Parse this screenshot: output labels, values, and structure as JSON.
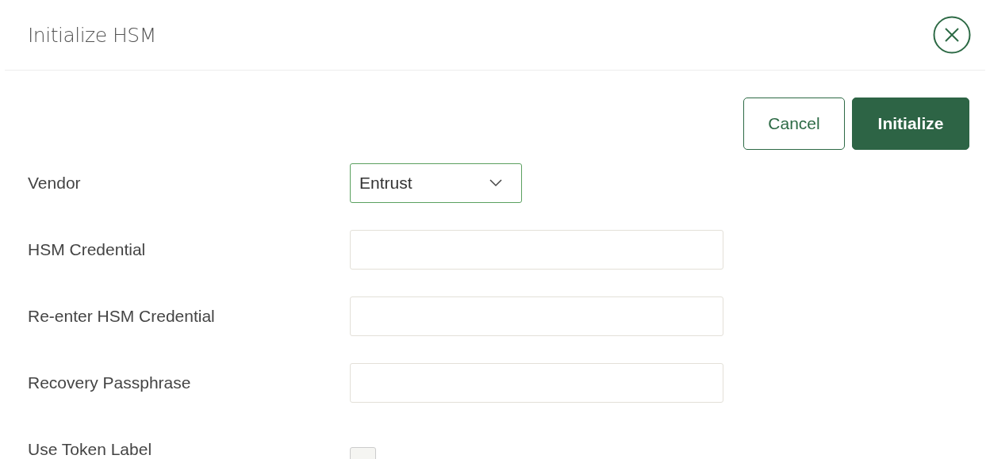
{
  "dialog": {
    "title": "Initialize HSM"
  },
  "buttons": [
    {
      "label": "Cancel",
      "kind": "secondary"
    },
    {
      "label": "Initialize",
      "kind": "primary"
    }
  ],
  "fields": [
    {
      "label": "Vendor",
      "kind": "select",
      "value": "Entrust"
    },
    {
      "label": "HSM Credential",
      "kind": "text"
    },
    {
      "label": "Re-enter HSM Credential",
      "kind": "text"
    },
    {
      "label": "Recovery Passphrase",
      "kind": "text"
    },
    {
      "label": "Use Token Label",
      "kind": "checkbox",
      "checked": false
    }
  ]
}
